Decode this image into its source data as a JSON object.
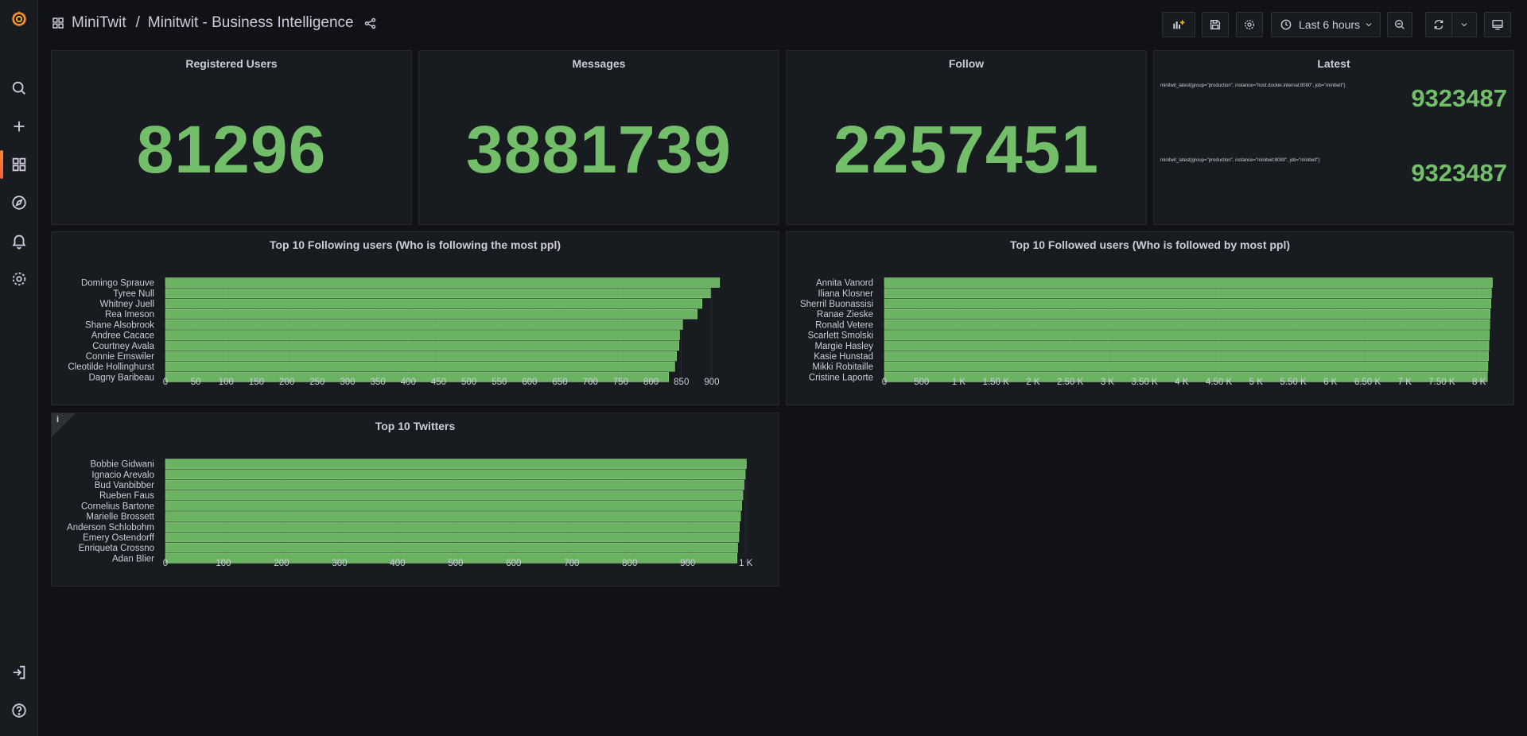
{
  "breadcrumb": {
    "folder": "MiniTwit",
    "dashboard": "Minitwit - Business Intelligence"
  },
  "toolbar": {
    "time_range": "Last 6 hours"
  },
  "colors": {
    "accent": "#73bf69",
    "background": "#111217",
    "panel": "#181b1f"
  },
  "stats": [
    {
      "title": "Registered Users",
      "value": "81296"
    },
    {
      "title": "Messages",
      "value": "3881739"
    },
    {
      "title": "Follow",
      "value": "2257451"
    }
  ],
  "latest": {
    "title": "Latest",
    "rows": [
      {
        "label": "minitwit_latest{group=\"production\", instance=\"host.docker.internal:8080\", job=\"minitwit\"}",
        "value": "9323487"
      },
      {
        "label": "minitwit_latest{group=\"production\", instance=\"minitwit:8080\", job=\"minitwit\"}",
        "value": "9323487"
      }
    ]
  },
  "chart_data": [
    {
      "type": "bar",
      "orientation": "horizontal",
      "title": "Top 10 Following users (Who is following the most ppl)",
      "categories": [
        "Domingo Sprauve",
        "Tyree Null",
        "Whitney Juell",
        "Rea Imeson",
        "Shane Alsobrook",
        "Andree Cacace",
        "Courtney Avala",
        "Connie Emswiler",
        "Cleotilde Hollinghurst",
        "Dagny Baribeau"
      ],
      "values": [
        913,
        898,
        884,
        876,
        852,
        847,
        846,
        842,
        839,
        829
      ],
      "xlim": [
        0,
        925
      ],
      "ticks": [
        0,
        50,
        100,
        150,
        200,
        250,
        300,
        350,
        400,
        450,
        500,
        550,
        600,
        650,
        700,
        750,
        800,
        850,
        900
      ],
      "tick_labels": [
        "0",
        "50",
        "100",
        "150",
        "200",
        "250",
        "300",
        "350",
        "400",
        "450",
        "500",
        "550",
        "600",
        "650",
        "700",
        "750",
        "800",
        "850",
        "900"
      ]
    },
    {
      "type": "bar",
      "orientation": "horizontal",
      "title": "Top 10 Followed users (Who is followed by most ppl)",
      "categories": [
        "Annita Vanord",
        "Iliana Klosner",
        "Sherril Buonassisi",
        "Ranae Zieske",
        "Ronald Vetere",
        "Scarlett Smolski",
        "Margie Hasley",
        "Kasie Hunstad",
        "Mikki Robitaille",
        "Cristine Laporte"
      ],
      "values": [
        8180,
        8168,
        8160,
        8150,
        8145,
        8140,
        8133,
        8128,
        8120,
        8113
      ],
      "xlim": [
        0,
        8250
      ],
      "ticks": [
        0,
        500,
        1000,
        1500,
        2000,
        2500,
        3000,
        3500,
        4000,
        4500,
        5000,
        5500,
        6000,
        6500,
        7000,
        7500,
        8000
      ],
      "tick_labels": [
        "0",
        "500",
        "1 K",
        "1.50 K",
        "2 K",
        "2.50 K",
        "3 K",
        "3.50 K",
        "4 K",
        "4.50 K",
        "5 K",
        "5.50 K",
        "6 K",
        "6.50 K",
        "7 K",
        "7.50 K",
        "8 K"
      ]
    },
    {
      "type": "bar",
      "orientation": "horizontal",
      "title": "Top 10 Twitters",
      "categories": [
        "Bobbie Gidwani",
        "Ignacio Arevalo",
        "Bud Vanbibber",
        "Rueben Faus",
        "Cornelius Bartone",
        "Marielle Brossett",
        "Anderson Schlobohm",
        "Emery Ostendorff",
        "Enriqueta Crossno",
        "Adan Blier"
      ],
      "values": [
        1001,
        999,
        997,
        995,
        993,
        991,
        989,
        988,
        986,
        985
      ],
      "xlim": [
        0,
        1010
      ],
      "ticks": [
        0,
        100,
        200,
        300,
        400,
        500,
        600,
        700,
        800,
        900,
        1000
      ],
      "tick_labels": [
        "0",
        "100",
        "200",
        "300",
        "400",
        "500",
        "600",
        "700",
        "800",
        "900",
        "1 K"
      ]
    }
  ]
}
